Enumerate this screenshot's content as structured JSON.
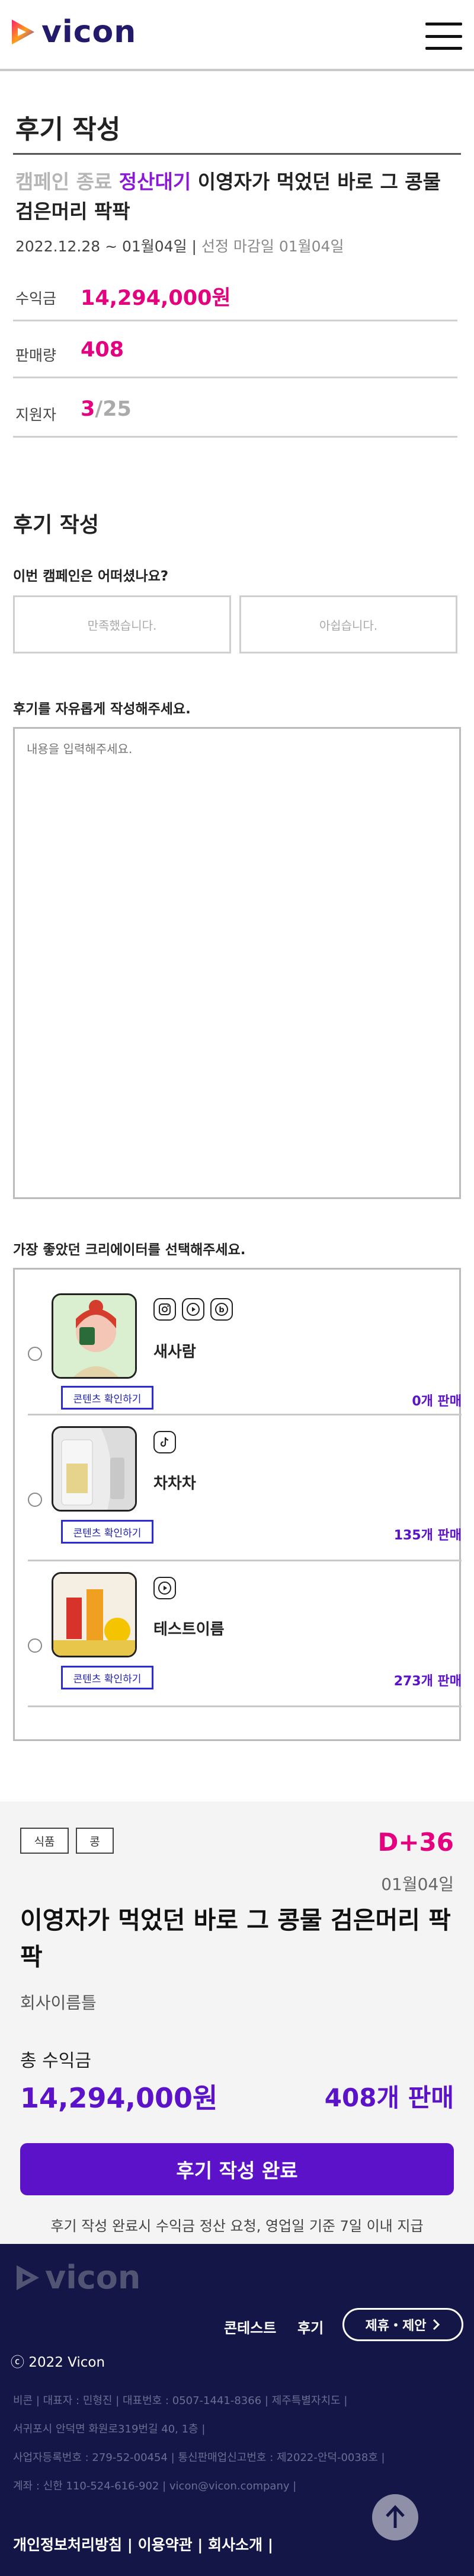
{
  "header": {
    "logo_text": "vicon",
    "menu_icon": "hamburger-menu-icon"
  },
  "page": {
    "title": "후기 작성"
  },
  "campaign": {
    "status1": "캠페인 종료",
    "status2": "정산대기",
    "title": "이영자가 먹었던 바로 그 콩물 검은머리 팍팍",
    "period": "2022.12.28 ~ 01월04일 |",
    "deadline": "선정 마감일 01월04일"
  },
  "stats": {
    "revenue_label": "수익금",
    "revenue_value": "14,294,000원",
    "sales_label": "판매량",
    "sales_value": "408",
    "applicants_label": "지원자",
    "applicants_value": "3",
    "applicants_total": "/25"
  },
  "review": {
    "section_title": "후기 작성",
    "question": "이번 캠페인은 어떠셨나요?",
    "choice_satisfied": "만족했습니다.",
    "choice_unsatisfied": "아쉽습니다.",
    "free_label": "후기를 자유롭게 작성해주세요.",
    "textarea_placeholder": "내용을 입력해주세요.",
    "creator_label": "가장 좋았던 크리에이터를 선택해주세요."
  },
  "creators": [
    {
      "name": "새사람",
      "sns": [
        "instagram-icon",
        "youtube-icon",
        "blog-icon"
      ],
      "content_button": "콘텐츠 확인하기",
      "sales": "0개 판매"
    },
    {
      "name": "차차차",
      "sns": [
        "tiktok-icon"
      ],
      "content_button": "콘텐츠 확인하기",
      "sales": "135개 판매"
    },
    {
      "name": "테스트이름",
      "sns": [
        "youtube-icon"
      ],
      "content_button": "콘텐츠 확인하기",
      "sales": "273개 판매"
    }
  ],
  "summary": {
    "tag1": "식품",
    "tag2": "콩",
    "dday": "D+36",
    "date": "01월04일",
    "title": "이영자가 먹었던 바로 그 콩물 검은머리 팍팍",
    "company": "회사이름틀",
    "total_label": "총 수익금",
    "total_value": "14,294,000원",
    "sales": "408개 판매",
    "done_button": "후기 작성 완료",
    "note": "후기 작성 완료시 수익금 정산 요청, 영업일 기준 7일 이내 지급"
  },
  "footer": {
    "logo_text": "vicon",
    "nav_contest": "콘테스트",
    "nav_review": "후기",
    "partner_button": "제휴・제안",
    "copyright": "ⓒ 2022 Vicon",
    "info1": "비콘 | 대표자 : 민형진 | 대표번호 : 0507-1441-8366 | 제주특별자치도 |",
    "info2": "서귀포시 안덕면 화원로319번길 40, 1층 |",
    "info3": "사업자등록번호 : 279-52-00454 | 통신판매업신고번호 : 제2022-안덕-0038호 |",
    "info4": "계좌 : 신한 110-524-616-902 | vicon@vicon.company |",
    "link_privacy": "개인정보처리방침",
    "link_terms": "이용약관",
    "link_company": "회사소개",
    "sep": " | "
  },
  "colors": {
    "brand_purple": "#5b12c9",
    "accent_pink": "#e4007f",
    "footer_navy": "#131647"
  }
}
